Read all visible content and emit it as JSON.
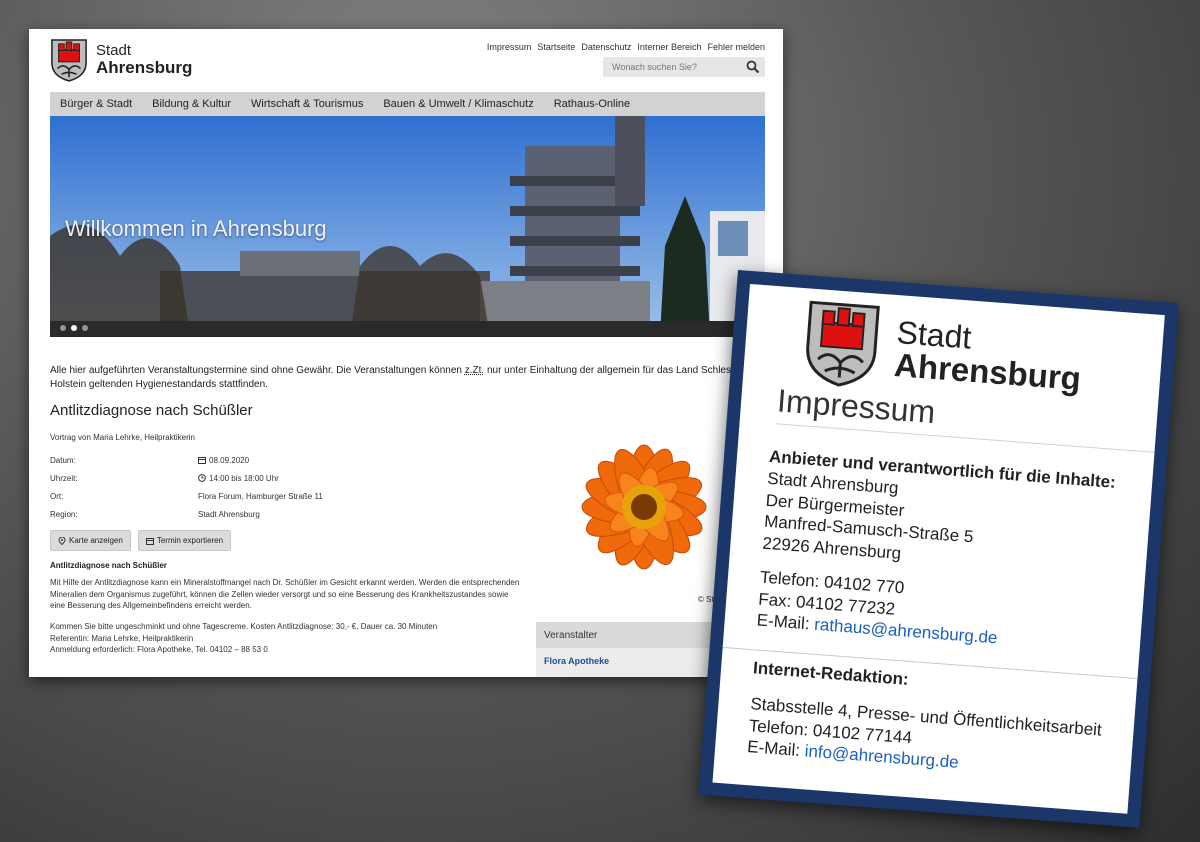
{
  "site": {
    "logo": {
      "line1": "Stadt",
      "line2": "Ahrensburg"
    },
    "util_links": [
      "Impressum",
      "Startseite",
      "Datenschutz",
      "Interner Bereich",
      "Fehler melden"
    ],
    "search": {
      "placeholder": "Wonach suchen Sie?"
    },
    "nav": [
      "Bürger & Stadt",
      "Bildung & Kultur",
      "Wirtschaft & Tourismus",
      "Bauen & Umwelt / Klimaschutz",
      "Rathaus-Online"
    ],
    "hero": {
      "title": "Willkommen in Ahrensburg",
      "active_slide": 2,
      "slides": 3
    },
    "notice": {
      "part1": "Alle hier aufgeführten Veranstaltungstermine sind ohne Gewähr. Die Veranstaltungen können ",
      "abbr": "z.Zt.",
      "part2": " nur unter Einhaltung der allgemein für das Land Schleswig-Holstein geltenden Hygienestandards stattfinden."
    },
    "event": {
      "title": "Antlitzdiagnose nach Schüßler",
      "subtitle": "Vortrag von Maria Lehrke, Heilpraktikerin",
      "details": [
        {
          "label": "Datum:",
          "value": "08.09.2020",
          "icon": "calendar-icon"
        },
        {
          "label": "Uhrzeit:",
          "value": "14:00 bis 18:00 Uhr",
          "icon": "clock-icon"
        },
        {
          "label": "Ort:",
          "value": "Flora Forum, Hamburger Straße 11",
          "icon": ""
        },
        {
          "label": "Region:",
          "value": "Stadt Ahrensburg",
          "icon": ""
        }
      ],
      "buttons": {
        "map": "Karte anzeigen",
        "export": "Termin exportieren"
      },
      "body_heading": "Antlitzdiagnose nach Schüßler",
      "body_p1": "Mit Hilfe der Antlitzdiagnose kann ein Mineralstoffmangel nach Dr. Schüßler im Gesicht erkannt werden. Werden die entsprechenden Mineralien dem Organismus zugeführt, können die Zellen wieder versorgt und so eine Besserung des Krankheitszustandes sowie eine Besserung des Allgemeinbefindens erreicht werden.",
      "body_p2_lines": [
        "Kommen Sie bitte ungeschminkt und ohne Tagescreme. Kosten Antlitzdiagnose: 30,- €, Dauer ca. 30 Minuten",
        "Referentin: Maria Lehrke, Heilpraktikerin",
        "Anmeldung erforderlich: Flora Apotheke, Tel. 04102 – 88 53 0"
      ],
      "image_credit": "© Stadtb"
    },
    "organizer": {
      "heading": "Veranstalter",
      "name": "Flora Apotheke"
    }
  },
  "card": {
    "logo": {
      "line1": "Stadt",
      "line2": "Ahrensburg"
    },
    "title": "Impressum",
    "provider_heading": "Anbieter und verantwortlich für die Inhalte:",
    "address": [
      "Stadt Ahrensburg",
      "Der Bürgermeister",
      "Manfred-Samusch-Straße 5",
      "22926 Ahrensburg"
    ],
    "phone": "Telefon: 04102 770",
    "fax": "Fax: 04102 77232",
    "email_label": "E-Mail: ",
    "email": "rathaus@ahrensburg.de",
    "editorial_heading": "Internet-Redaktion:",
    "editorial_unit": "Stabsstelle 4, Presse- und Öffentlichkeitsarbeit",
    "editorial_phone": "Telefon: 04102 77144",
    "editorial_email_label": "E-Mail: ",
    "editorial_email": "info@ahrensburg.de"
  },
  "colors": {
    "accent_link": "#1c5fc3",
    "card_frame": "#1b3769",
    "nav_bg": "#d2d2d2"
  }
}
